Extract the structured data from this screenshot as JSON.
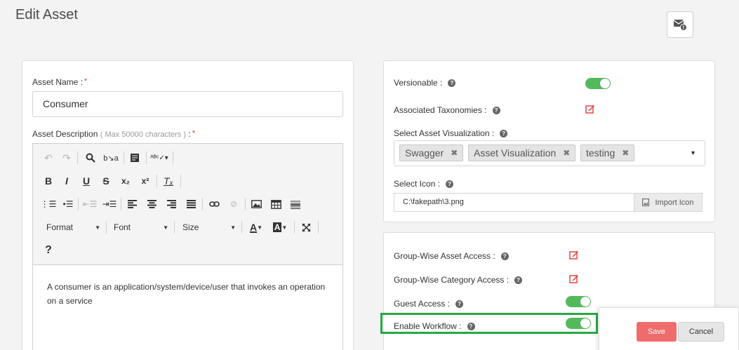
{
  "page": {
    "title": "Edit Asset"
  },
  "asset_name": {
    "label": "Asset Name :",
    "required_mark": "*",
    "value": "Consumer"
  },
  "asset_description": {
    "label": "Asset Description",
    "hint": "( Max 50000 characters )",
    "colon": ":",
    "required_mark": "*",
    "toolbar": {
      "format": "Format",
      "font": "Font",
      "size": "Size",
      "help": "?"
    },
    "body": "A consumer is an application/system/device/user that invokes an operation on a service"
  },
  "visibility": {
    "versionable_label": "Versionable :",
    "versionable_on": true,
    "taxonomies_label": "Associated Taxonomies :",
    "visualization_label": "Select Asset Visualization :",
    "visualization_tags": [
      "Swagger",
      "Asset Visualization",
      "testing"
    ],
    "icon_label": "Select Icon :",
    "icon_value": "C:\\fakepath\\3.png",
    "import_icon": "Import Icon"
  },
  "access": {
    "group_asset_label": "Group-Wise Asset Access :",
    "group_category_label": "Group-Wise Category Access :",
    "guest_label": "Guest Access :",
    "guest_on": true,
    "workflow_label": "Enable Workflow :",
    "workflow_on": true
  },
  "actions": {
    "save": "Save",
    "cancel": "Cancel"
  },
  "colors": {
    "accent_green": "#52b95c",
    "save_red": "#f06c6c",
    "highlight_green": "#27a745",
    "edit_icon": "#e53935"
  }
}
